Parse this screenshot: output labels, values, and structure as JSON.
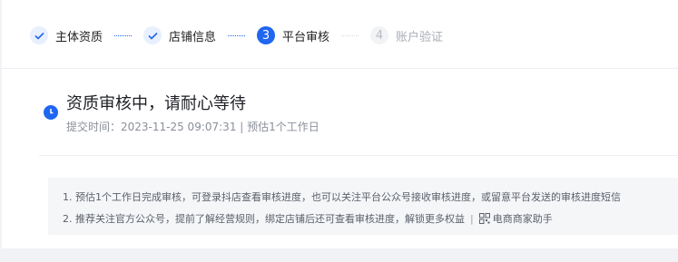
{
  "steps": [
    {
      "label": "主体资质",
      "state": "done",
      "number": "1"
    },
    {
      "label": "店铺信息",
      "state": "done",
      "number": "2"
    },
    {
      "label": "平台审核",
      "state": "active",
      "number": "3"
    },
    {
      "label": "账户验证",
      "state": "todo",
      "number": "4"
    }
  ],
  "status": {
    "title": "资质审核中，请耐心等待",
    "submitted": "提交时间：2023-11-25 09:07:31 | 预估1个工作日"
  },
  "notice": {
    "line1": "1. 预估1个工作日完成审核，可登录抖店查看审核进度，也可以关注平台公众号接收审核进度，或留意平台发送的审核进度短信",
    "line2": "2. 推荐关注官方公众号，提前了解经营规则，绑定店铺后还可查看审核进度，解锁更多权益",
    "separator": "|",
    "link": "电商商家助手"
  },
  "colors": {
    "accent": "#1f66f0",
    "bg": "#f0f2f5"
  },
  "icons": {
    "done": "check-icon",
    "status": "clock-icon",
    "qr": "qr-code-icon"
  }
}
